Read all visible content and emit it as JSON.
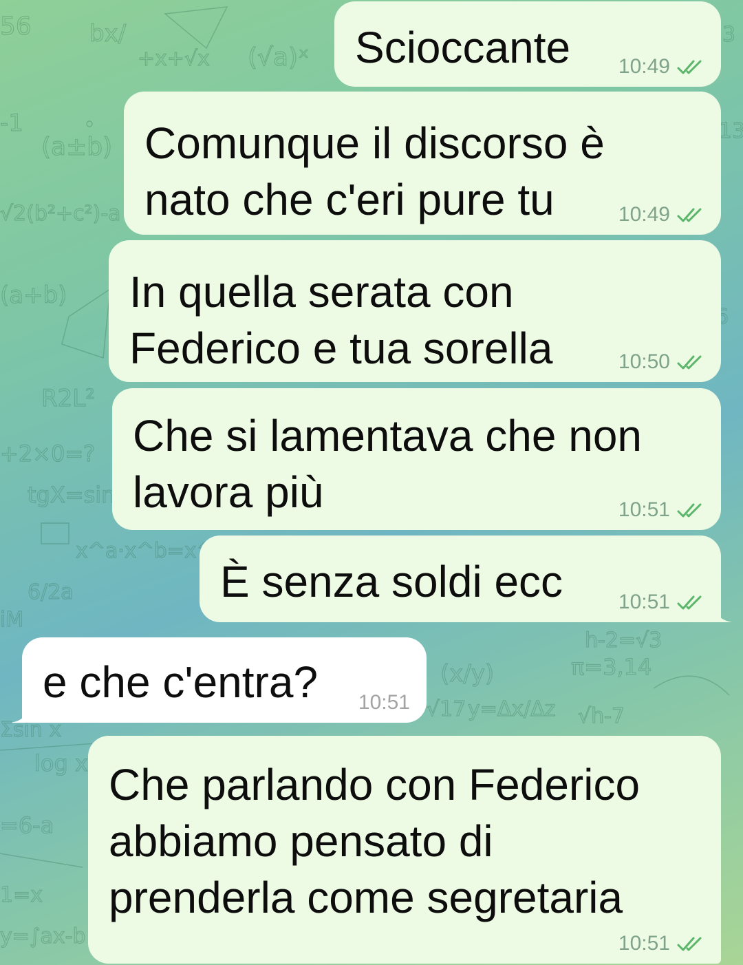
{
  "colors": {
    "outgoing_bubble": "#eefbe4",
    "incoming_bubble": "#ffffff",
    "outgoing_meta": "#7fa38a",
    "check_marks": "#5bb56a",
    "background_accent": "#7fc7a4"
  },
  "messages": [
    {
      "text": "Scioccante",
      "time": "10:49",
      "direction": "out",
      "status_icon": "double-check-icon"
    },
    {
      "text": "Comunque il discorso è\nnato che c'eri pure tu",
      "time": "10:49",
      "direction": "out",
      "status_icon": "double-check-icon"
    },
    {
      "text": "In quella serata con\nFederico e tua sorella",
      "time": "10:50",
      "direction": "out",
      "status_icon": "double-check-icon"
    },
    {
      "text": "Che si lamentava che non\nlavora più",
      "time": "10:51",
      "direction": "out",
      "status_icon": "double-check-icon"
    },
    {
      "text": "È senza soldi ecc",
      "time": "10:51",
      "direction": "out",
      "status_icon": "double-check-icon"
    },
    {
      "text": "e che c'entra?",
      "time": "10:51",
      "direction": "in"
    },
    {
      "text": "Che parlando con Federico\nabbiamo pensato di\nprenderla come segretaria",
      "time": "10:51",
      "direction": "out",
      "status_icon": "double-check-icon"
    }
  ]
}
